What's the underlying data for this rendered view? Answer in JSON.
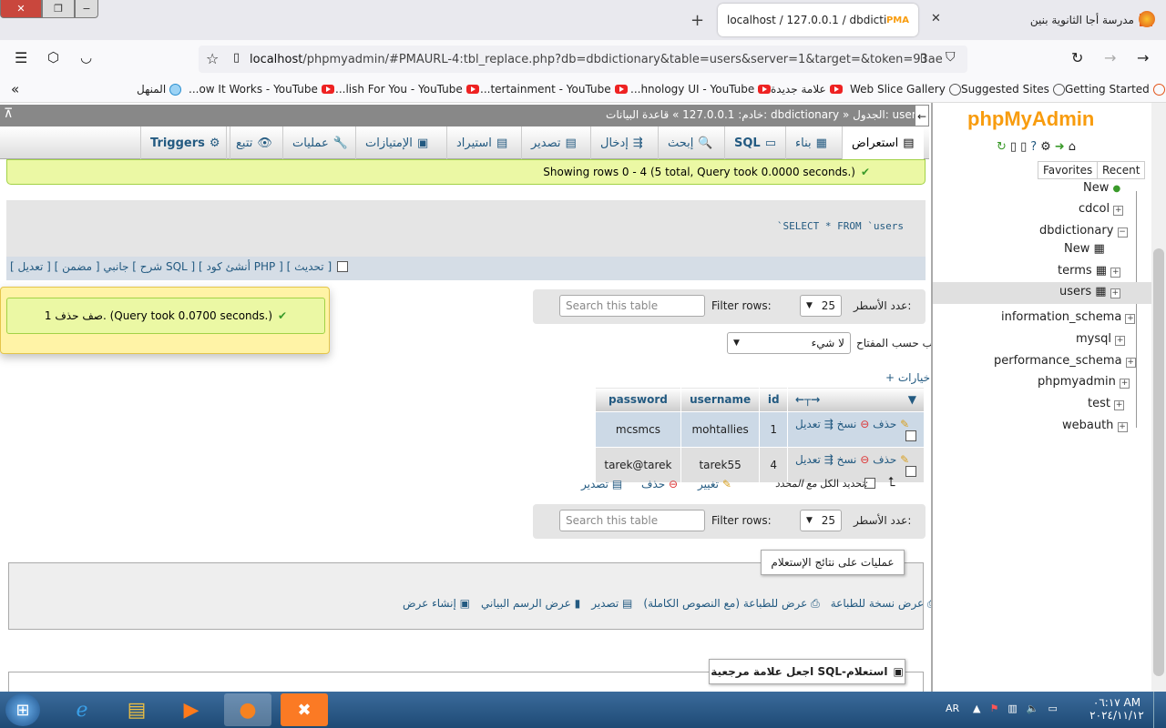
{
  "browser": {
    "tab_active_title": "localhost / 127.0.0.1 / dbdictio",
    "tab2_title": "مدرسة أجا الثانوية بنين",
    "url_prefix": "localhost",
    "url_rest": "/phpmyadmin/#PMAURL-4:tbl_replace.php?db=dbdictionary&table=users&server=1&target=&token=93ae",
    "bookmarks": [
      "Getting Started",
      "Suggested Sites",
      "Web Slice Gallery",
      "علامة جديدة",
      "...hnology UI - YouTube",
      "...tertainment - YouTube",
      "...lish For You - YouTube",
      "...ow It Works - YouTube",
      "المنهل"
    ]
  },
  "pma": {
    "logo_php": "php",
    "logo_myadmin": "MyAdmin",
    "nav_tabs": [
      "Favorites",
      "Recent"
    ],
    "tree": {
      "new": "New",
      "cdcol": "cdcol",
      "dbdictionary": "dbdictionary",
      "new2": "New",
      "terms": "terms",
      "users": "users",
      "information_schema": "information_schema",
      "mysql": "mysql",
      "performance_schema": "performance_schema",
      "phpmyadmin": "phpmyadmin",
      "test": "test",
      "webauth": "webauth"
    },
    "breadcrumb": "خادم: 127.0.0.1 » قاعدة البيانات: dbdictionary » الجدول: users",
    "menu": [
      "استعراض",
      "بناء",
      "SQL",
      "إبحث",
      "إدخال",
      "تصدير",
      "استيراد",
      "الإمتيازات",
      "عمليات",
      "تتبع",
      "Triggers"
    ],
    "success_rows": "Showing rows 0 - 4 (5 total, Query took 0.0000 seconds.)",
    "sql_text": "`SELECT * FROM `users",
    "sql_links": "جانبي [ مضمن ] [ تعديل ] [ شرح SQL ] [ أنشئ كود PHP ] [ تحديث ]",
    "notice": "1 صف حذف. (Query took 0.0700 seconds.)",
    "rows_label": "عدد الأسطر:",
    "rows_value": "25",
    "filter_label": "Filter rows:",
    "filter_placeholder": "Search this table",
    "sort_label": "رتّب حسب المفتاح:",
    "sort_value": "لا شيء",
    "options": "+ خيارات",
    "columns": [
      "id",
      "username",
      "password"
    ],
    "rows": [
      {
        "id": "1",
        "username": "mohtallies",
        "password": "mcsmcs"
      },
      {
        "id": "4",
        "username": "tarek55",
        "password": "tarek@tarek"
      }
    ],
    "row_actions": {
      "edit": "تعديل",
      "copy": "نسخ",
      "delete": "حذف"
    },
    "bulk": {
      "check_all": "تحديد الكل",
      "with_selected": "مع المحدد:",
      "change": "تغيير",
      "delete": "حذف",
      "export": "تصدير"
    },
    "query_ops_title": "عمليات على نتائج الإستعلام",
    "query_ops": [
      "عرض نسخة للطباعة",
      "عرض للطباعة (مع النصوص الكاملة)",
      "تصدير",
      "عرض الرسم البياني",
      "إنشاء عرض"
    ],
    "bookmark_title": "اجعل علامة مرجعية SQL-استعلام"
  },
  "taskbar": {
    "lang": "AR",
    "time": "٠٦:١٧ AM",
    "date": "٢٠٢٤/١١/١٢"
  }
}
